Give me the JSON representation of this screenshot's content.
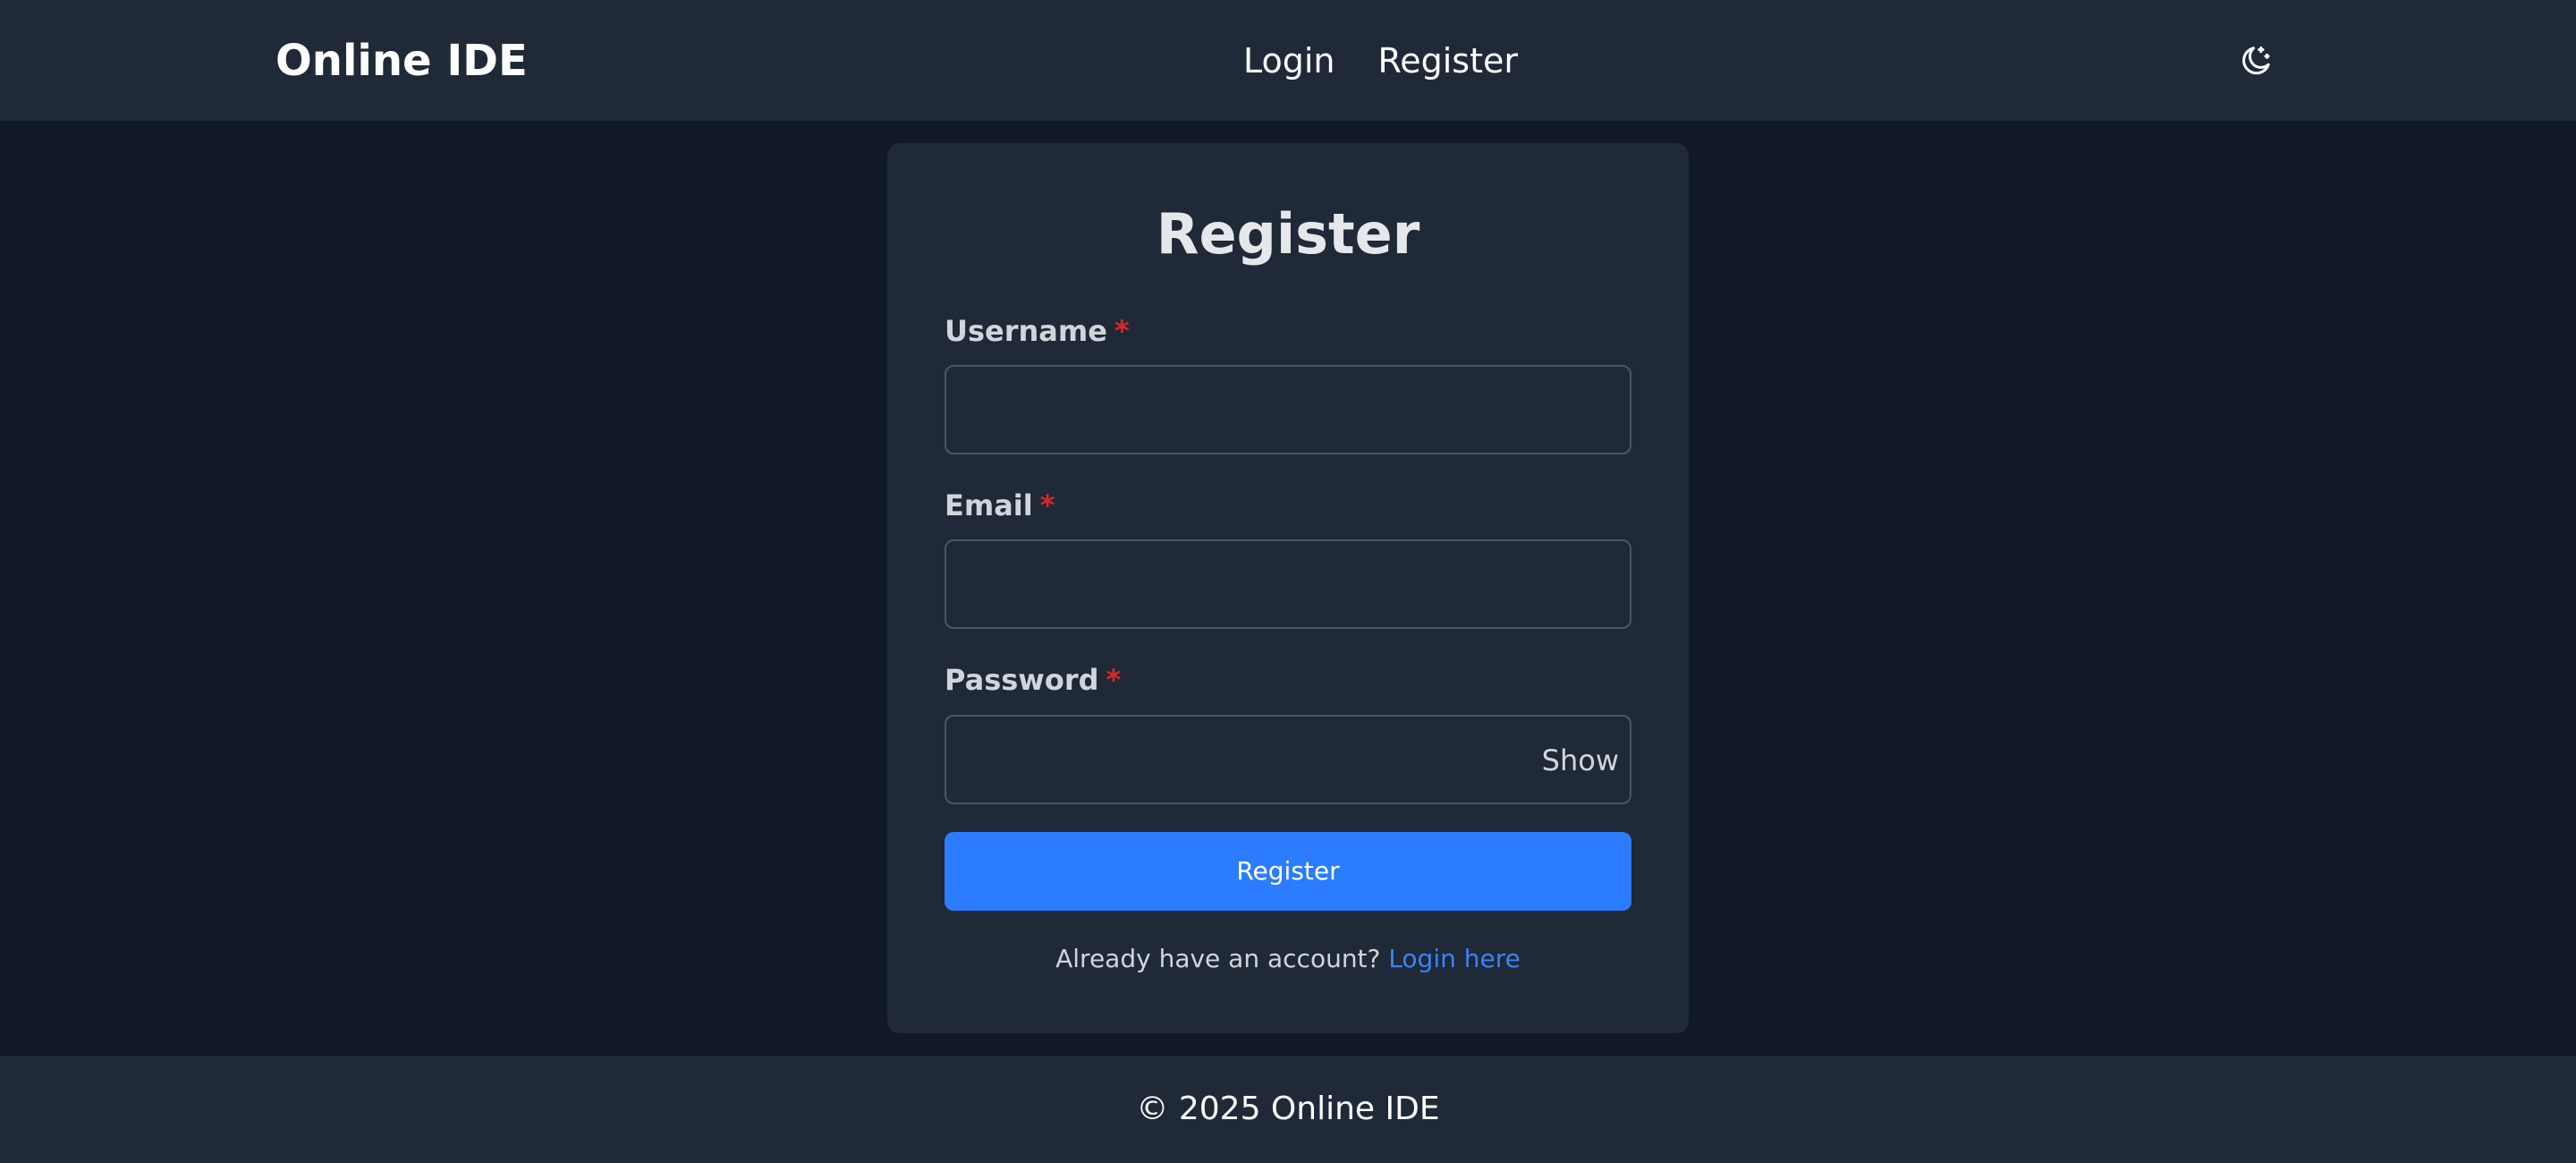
{
  "header": {
    "brand": "Online IDE",
    "nav": [
      {
        "label": "Login"
      },
      {
        "label": "Register"
      }
    ],
    "theme_icon": "moon-stars-icon"
  },
  "form": {
    "title": "Register",
    "required_marker": "*",
    "fields": {
      "username": {
        "label": "Username",
        "value": ""
      },
      "email": {
        "label": "Email",
        "value": ""
      },
      "password": {
        "label": "Password",
        "value": "",
        "toggle_label": "Show"
      }
    },
    "submit_label": "Register",
    "switch_prompt": "Already have an account?",
    "switch_link": "Login here"
  },
  "footer": {
    "text": "© 2025 Online IDE"
  },
  "colors": {
    "page_bg": "#111827",
    "panel_bg": "#1f2937",
    "accent": "#2b7cff",
    "link": "#3b82f6",
    "required": "#dc2626"
  }
}
